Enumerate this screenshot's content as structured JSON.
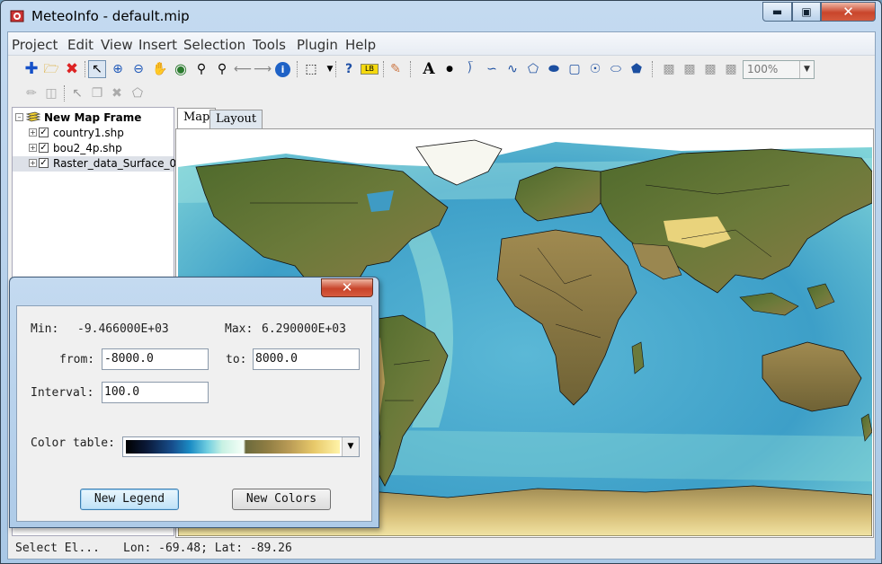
{
  "window": {
    "title": "MeteoInfo - default.mip",
    "icons": {
      "app": "meteoinfo-app-icon",
      "minimize": "minimize-icon",
      "maximize": "maximize-icon",
      "close": "close-icon"
    }
  },
  "menu": [
    "Project",
    "Edit",
    "View",
    "Insert",
    "Selection",
    "Tools",
    "Plugin",
    "Help"
  ],
  "toolbar": {
    "row1_icons": [
      "add-layer-icon",
      "open-folder-icon",
      "remove-layer-icon",
      "select-arrow-icon",
      "zoom-in-icon",
      "zoom-out-icon",
      "pan-hand-icon",
      "full-extent-globe-icon",
      "identify-magnifier-icon",
      "zoom-to-layer-icon",
      "back-arrow-icon",
      "forward-arrow-icon",
      "info-icon",
      "select-rectangle-icon",
      "dropdown-arrow-icon",
      "help-cursor-icon",
      "label-tool-icon",
      "edit-icon",
      "text-tool-icon",
      "point-tool-icon",
      "polyline-tool-icon",
      "freehand-line-icon",
      "curve-tool-icon",
      "polygon-tool-icon",
      "freehand-polygon-icon",
      "rectangle-tool-icon",
      "circle-tool-icon",
      "ellipse-tool-icon",
      "curve-polygon-icon",
      "page-icon",
      "page-zoom-in-icon",
      "page-zoom-out-icon",
      "page-fit-icon"
    ],
    "zoom_value": "100%",
    "row2_icons": [
      "pencil-edit-icon",
      "save-edit-icon",
      "select-feature-icon",
      "copy-feature-icon",
      "delete-feature-icon",
      "add-polygon-icon"
    ]
  },
  "layers": {
    "frame_label": "New Map Frame",
    "items": [
      {
        "label": "country1.shp",
        "checked": true
      },
      {
        "label": "bou2_4p.shp",
        "checked": true
      },
      {
        "label": "Raster_data_Surface_0",
        "checked": true
      }
    ]
  },
  "tabs": [
    "Map",
    "Layout"
  ],
  "status": {
    "left": "Select El...",
    "coords": "Lon: -69.48; Lat: -89.26"
  },
  "dialog": {
    "min_label": "Min:",
    "min_value": "-9.466000E+03",
    "max_label": "Max:",
    "max_value": "6.290000E+03",
    "from_label": "from:",
    "from_value": "-8000.0",
    "to_label": "to:",
    "to_value": "8000.0",
    "interval_label": "Interval:",
    "interval_value": "100.0",
    "color_table_label": "Color table:",
    "new_legend_button": "New Legend",
    "new_colors_button": "New Colors"
  },
  "colors": {
    "ocean_deep": "#3fa0c8",
    "ocean_shallow": "#9fe3e0",
    "land_low": "#556b2f",
    "land_high": "#e6cf7a",
    "ice": "#ffffff"
  }
}
